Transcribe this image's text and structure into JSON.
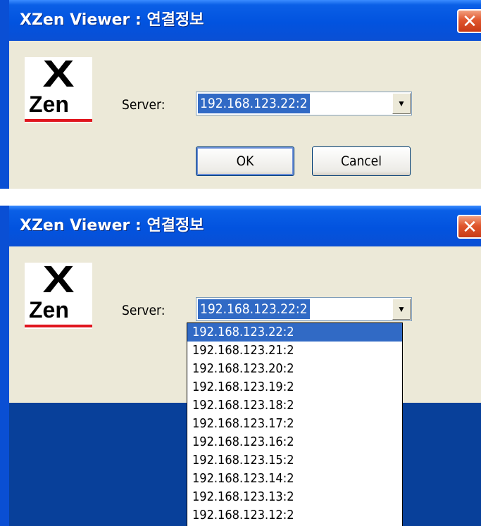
{
  "window_title": "XZen Viewer : 연결정보",
  "close_glyph": "✕",
  "logo": {
    "x": "X",
    "zen": "Zen",
    "accent_color": "#E0161E"
  },
  "server_label": "Server:",
  "server_value": "192.168.123.22:2",
  "dropdown_arrow": "▼",
  "buttons": {
    "ok": "OK",
    "cancel": "Cancel"
  },
  "server_options": [
    "192.168.123.22:2",
    "192.168.123.21:2",
    "192.168.123.20:2",
    "192.168.123.19:2",
    "192.168.123.18:2",
    "192.168.123.17:2",
    "192.168.123.16:2",
    "192.168.123.15:2",
    "192.168.123.14:2",
    "192.168.123.13:2",
    "192.168.123.12:2"
  ],
  "colors": {
    "titlebar": "#0253DF",
    "selection": "#316AC5",
    "dialog_bg": "#ECE9D8",
    "close": "#E0562D"
  }
}
